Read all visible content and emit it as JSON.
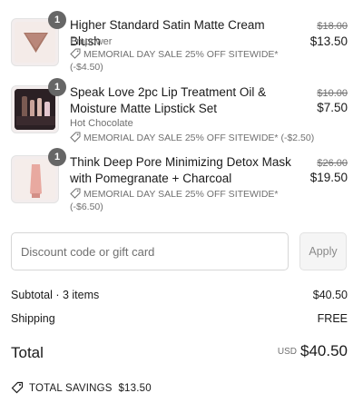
{
  "items": [
    {
      "quantity": "1",
      "title": "Higher Standard Satin Matte Cream Blush",
      "variant": "Empower",
      "discount_label": "MEMORIAL DAY SALE 25% OFF SITEWIDE*",
      "discount_amount": "(-$4.50)",
      "original_price": "$18.00",
      "price": "$13.50",
      "icon": "tag-icon"
    },
    {
      "quantity": "1",
      "title": "Speak Love 2pc Lip Treatment Oil & Moisture Matte Lipstick Set",
      "variant": "Hot Chocolate",
      "discount_label": "MEMORIAL DAY SALE 25% OFF SITEWIDE*",
      "discount_amount": "(-$2.50)",
      "original_price": "$10.00",
      "price": "$7.50",
      "icon": "tag-icon"
    },
    {
      "quantity": "1",
      "title": "Think Deep Pore Minimizing Detox Mask with Pomegranate + Charcoal",
      "variant": "",
      "discount_label": "MEMORIAL DAY SALE 25% OFF SITEWIDE*",
      "discount_amount": "(-$6.50)",
      "original_price": "$26.00",
      "price": "$19.50",
      "icon": "tag-icon"
    }
  ],
  "discount": {
    "placeholder": "Discount code or gift card",
    "apply_label": "Apply"
  },
  "summary": {
    "subtotal_label": "Subtotal · 3 items",
    "subtotal_value": "$40.50",
    "shipping_label": "Shipping",
    "shipping_value": "FREE",
    "total_label": "Total",
    "currency": "USD",
    "total_value": "$40.50",
    "savings_label": "TOTAL SAVINGS",
    "savings_value": "$13.50"
  }
}
